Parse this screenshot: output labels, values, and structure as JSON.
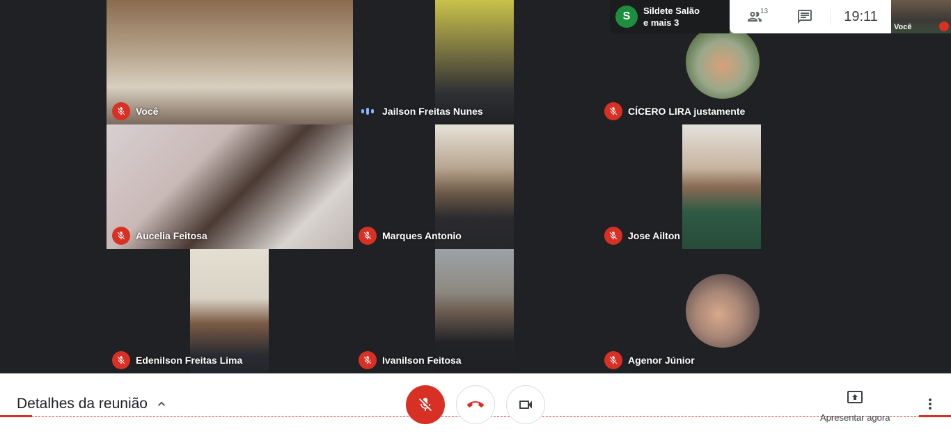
{
  "tiles": [
    {
      "name": "Você",
      "status": "muted"
    },
    {
      "name": "Jailson Freitas Nunes",
      "status": "speaking"
    },
    {
      "name": "CÍCERO LIRA justamente",
      "status": "muted"
    },
    {
      "name": "Aucelia Feitosa",
      "status": "muted"
    },
    {
      "name": "Marques Antonio",
      "status": "muted"
    },
    {
      "name": "Jose Ailton",
      "status": "muted"
    },
    {
      "name": "Edenilson Freitas Lima",
      "status": "muted"
    },
    {
      "name": "Ivanilson Feitosa",
      "status": "muted"
    },
    {
      "name": "Agenor Júnior",
      "status": "muted"
    }
  ],
  "notification": {
    "avatar_letter": "S",
    "line1": "Sildete Salão",
    "line2": "e mais 3"
  },
  "topbar": {
    "participants_count": "13",
    "time": "19:11"
  },
  "self_view": {
    "label": "Você"
  },
  "bottom": {
    "details_label": "Detalhes da reunião",
    "present_label": "Apresentar agora"
  },
  "icons": {
    "mic_off": "mic-off-icon",
    "hangup": "call-end-icon",
    "camera": "videocam-icon",
    "participants": "people-icon",
    "chat": "chat-icon",
    "present": "present-to-all-icon",
    "more": "more-vert-icon",
    "chevron": "chevron-up-icon"
  },
  "colors": {
    "mute_red": "#d93025",
    "speaking_blue": "#8ab4f8",
    "avatar_green": "#1e8e3e"
  }
}
